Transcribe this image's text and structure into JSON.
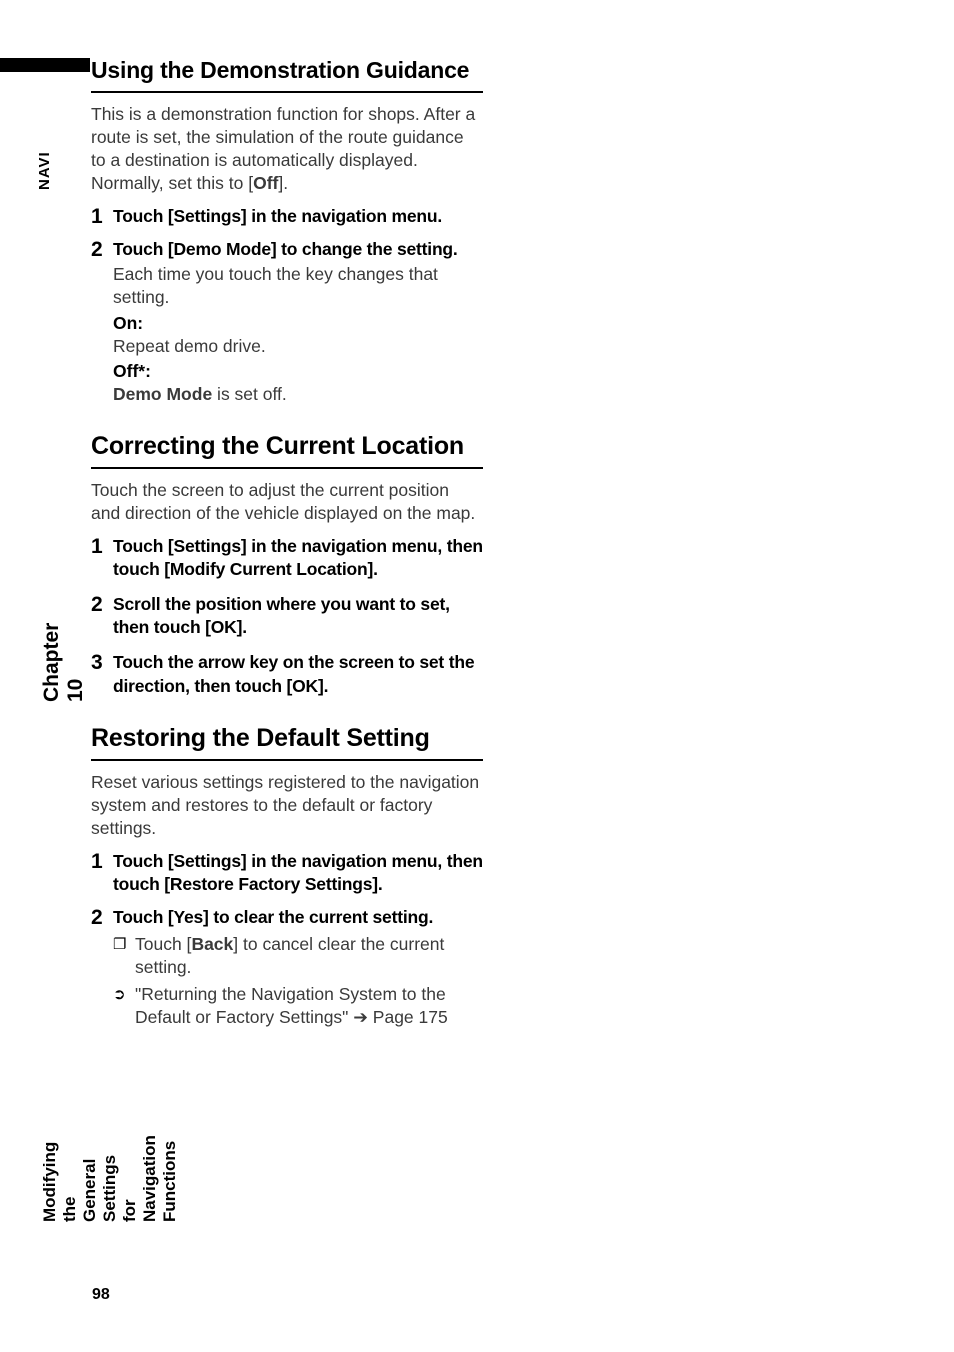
{
  "side": {
    "navi": "NAVI",
    "chapter": "Chapter 10",
    "long_title": "Modifying the General Settings for Navigation Functions"
  },
  "section1": {
    "title": "Using the Demonstration Guidance",
    "intro_a": "This is a demonstration function for shops. After a route is set, the simulation of the route guidance to a destination is automatically displayed. Normally, set this to [",
    "intro_off": "Off",
    "intro_b": "].",
    "step1_num": "1",
    "step1_head": "Touch [Settings] in the navigation menu.",
    "step2_num": "2",
    "step2_head": "Touch [Demo Mode] to change the setting.",
    "step2_sub": "Each time you touch the key changes that setting.",
    "values": {
      "on_label": "On:",
      "on_desc": "Repeat demo drive.",
      "off_label": "Off*:",
      "off_desc_a": "Demo Mode",
      "off_desc_b": " is set off."
    }
  },
  "section2": {
    "title": "Correcting the Current Location",
    "intro": "Touch the screen to adjust the current position and direction of the vehicle displayed on the map.",
    "step1_num": "1",
    "step1_head": "Touch [Settings] in the navigation menu, then touch [Modify Current Location].",
    "step2_num": "2",
    "step2_head": "Scroll the position where you want to set, then touch [OK].",
    "step3_num": "3",
    "step3_head": "Touch the arrow key on the screen to set the direction, then touch [OK]."
  },
  "section3": {
    "title": "Restoring the Default Setting",
    "intro": "Reset various settings registered to the navigation system and restores to the default or factory settings.",
    "step1_num": "1",
    "step1_head": "Touch [Settings] in the navigation menu, then touch [Restore Factory Settings].",
    "step2_num": "2",
    "step2_head": "Touch [Yes] to clear the current setting.",
    "note1_mark": "❐",
    "note1_a": "Touch [",
    "note1_back": "Back",
    "note1_b": "] to cancel clear the current setting.",
    "note2_mark": "➲",
    "note2_a": "\"Returning the Navigation System to the Default or Factory Settings\" ",
    "note2_arrow": "➔",
    "note2_b": " Page 175"
  },
  "page_number": "98"
}
